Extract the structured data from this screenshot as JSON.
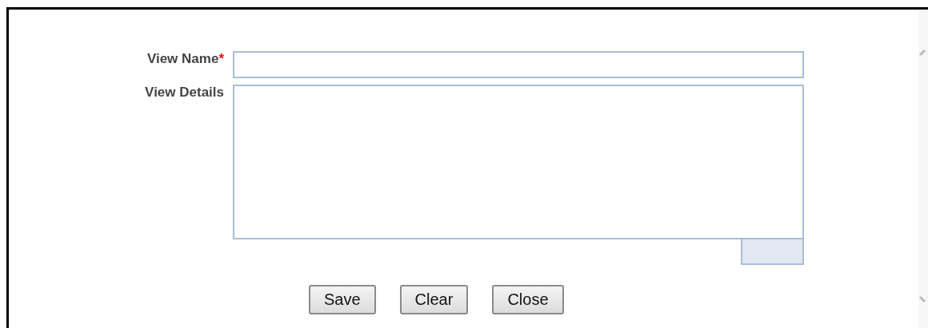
{
  "form": {
    "fields": [
      {
        "kind": "text",
        "label": "View Name",
        "required_mark": "*"
      },
      {
        "kind": "textarea",
        "label": "View Details"
      }
    ]
  },
  "buttons": [
    "Save",
    "Clear",
    "Close"
  ]
}
